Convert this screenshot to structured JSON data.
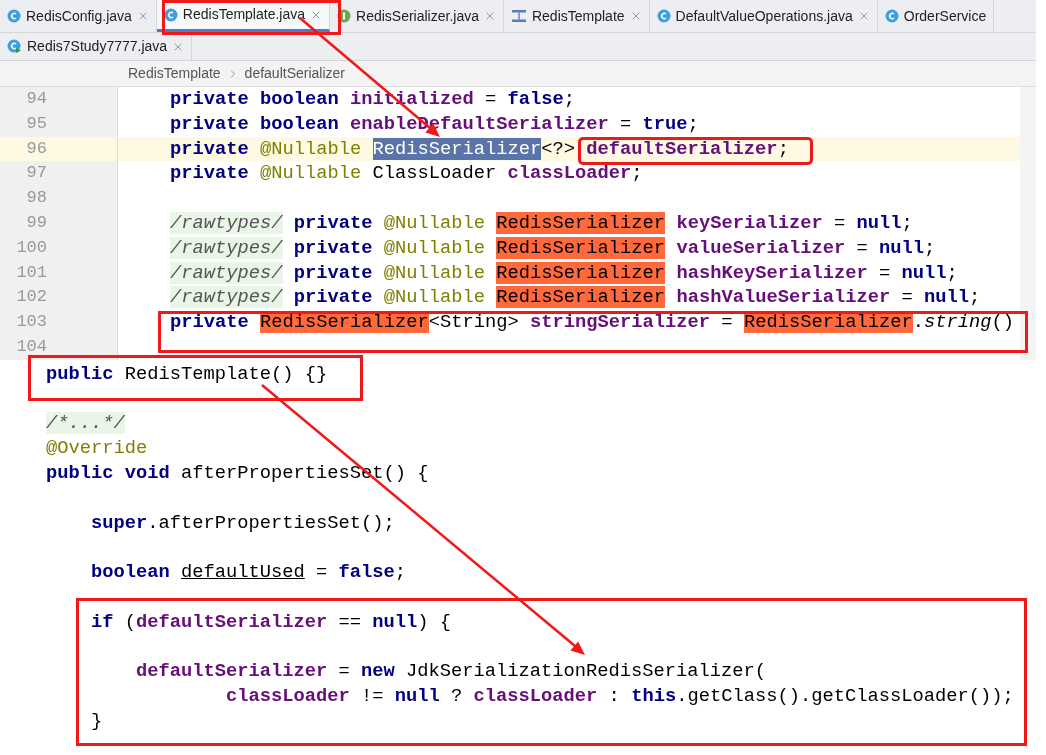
{
  "tab_rows": [
    {
      "tabs": [
        {
          "label": "RedisConfig.java",
          "kind": "class",
          "selected": false,
          "closable": true
        },
        {
          "label": "RedisTemplate.java",
          "kind": "class",
          "selected": true,
          "closable": true
        },
        {
          "label": "RedisSerializer.java",
          "kind": "interface",
          "selected": false,
          "closable": true
        },
        {
          "label": "RedisTemplate",
          "kind": "structure",
          "selected": false,
          "closable": true
        },
        {
          "label": "DefaultValueOperations.java",
          "kind": "class",
          "selected": false,
          "closable": true
        },
        {
          "label": "OrderService",
          "kind": "class",
          "selected": false,
          "closable": false
        }
      ]
    },
    {
      "tabs": [
        {
          "label": "Redis7Study7777.java",
          "kind": "runnable",
          "selected": false,
          "closable": true
        }
      ]
    }
  ],
  "breadcrumb": [
    "RedisTemplate",
    "defaultSerializer"
  ],
  "editor_top": {
    "lines": [
      {
        "number": "94",
        "current": false,
        "tokens": [
          {
            "kind": "keyword",
            "text": "private boolean "
          },
          {
            "kind": "field",
            "text": "initialized"
          },
          {
            "kind": "plain",
            "text": " = "
          },
          {
            "kind": "keyword",
            "text": "false"
          },
          {
            "kind": "plain",
            "text": ";"
          }
        ]
      },
      {
        "number": "95",
        "current": false,
        "tokens": [
          {
            "kind": "keyword",
            "text": "private boolean "
          },
          {
            "kind": "field",
            "text": "enableDefaultSerializer"
          },
          {
            "kind": "plain",
            "text": " = "
          },
          {
            "kind": "keyword",
            "text": "true"
          },
          {
            "kind": "plain",
            "text": ";"
          }
        ]
      },
      {
        "number": "96",
        "current": true,
        "tokens": [
          {
            "kind": "keyword",
            "text": "private "
          },
          {
            "kind": "annotation",
            "text": "@Nullable "
          },
          {
            "kind": "selected",
            "text": "RedisSerializer"
          },
          {
            "kind": "plain",
            "text": "<?> "
          },
          {
            "kind": "field",
            "text": "defaultSerializer"
          },
          {
            "kind": "plain",
            "text": ";"
          }
        ]
      },
      {
        "number": "97",
        "current": false,
        "tokens": [
          {
            "kind": "keyword",
            "text": "private "
          },
          {
            "kind": "annotation",
            "text": "@Nullable "
          },
          {
            "kind": "plain",
            "text": "ClassLoader "
          },
          {
            "kind": "field",
            "text": "classLoader"
          },
          {
            "kind": "plain",
            "text": ";"
          }
        ]
      },
      {
        "number": "98",
        "current": false
      },
      {
        "number": "99",
        "current": false,
        "tokens": [
          {
            "kind": "folded",
            "text": "/rawtypes/"
          },
          {
            "kind": "keyword",
            "text": " private "
          },
          {
            "kind": "annotation",
            "text": "@Nullable "
          },
          {
            "kind": "usage",
            "text": "RedisSerializer"
          },
          {
            "kind": "field",
            "text": " keySerializer"
          },
          {
            "kind": "plain",
            "text": " = "
          },
          {
            "kind": "keyword",
            "text": "null"
          },
          {
            "kind": "plain",
            "text": ";"
          }
        ]
      },
      {
        "number": "100",
        "current": false,
        "tokens": [
          {
            "kind": "folded",
            "text": "/rawtypes/"
          },
          {
            "kind": "keyword",
            "text": " private "
          },
          {
            "kind": "annotation",
            "text": "@Nullable "
          },
          {
            "kind": "usage",
            "text": "RedisSerializer"
          },
          {
            "kind": "field",
            "text": " valueSerializer"
          },
          {
            "kind": "plain",
            "text": " = "
          },
          {
            "kind": "keyword",
            "text": "null"
          },
          {
            "kind": "plain",
            "text": ";"
          }
        ]
      },
      {
        "number": "101",
        "current": false,
        "tokens": [
          {
            "kind": "folded",
            "text": "/rawtypes/"
          },
          {
            "kind": "keyword",
            "text": " private "
          },
          {
            "kind": "annotation",
            "text": "@Nullable "
          },
          {
            "kind": "usage",
            "text": "RedisSerializer"
          },
          {
            "kind": "field",
            "text": " hashKeySerializer"
          },
          {
            "kind": "plain",
            "text": " = "
          },
          {
            "kind": "keyword",
            "text": "null"
          },
          {
            "kind": "plain",
            "text": ";"
          }
        ]
      },
      {
        "number": "102",
        "current": false,
        "tokens": [
          {
            "kind": "folded",
            "text": "/rawtypes/"
          },
          {
            "kind": "keyword",
            "text": " private "
          },
          {
            "kind": "annotation",
            "text": "@Nullable "
          },
          {
            "kind": "usage",
            "text": "RedisSerializer"
          },
          {
            "kind": "field",
            "text": " hashValueSerializer"
          },
          {
            "kind": "plain",
            "text": " = "
          },
          {
            "kind": "keyword",
            "text": "null"
          },
          {
            "kind": "plain",
            "text": ";"
          }
        ]
      },
      {
        "number": "103",
        "current": false,
        "tokens": [
          {
            "kind": "keyword",
            "text": "private "
          },
          {
            "kind": "usage",
            "text": "RedisSerializer"
          },
          {
            "kind": "plain",
            "text": "<String> "
          },
          {
            "kind": "field",
            "text": "stringSerializer"
          },
          {
            "kind": "plain",
            "text": " = "
          },
          {
            "kind": "usage",
            "text": "RedisSerializer"
          },
          {
            "kind": "plain",
            "text": "."
          },
          {
            "kind": "static",
            "text": "string"
          },
          {
            "kind": "plain",
            "text": "()"
          }
        ]
      },
      {
        "number": "104",
        "current": false
      }
    ]
  },
  "editor_bottom": {
    "lines": [
      {
        "kind": "code",
        "tokens": [
          {
            "kind": "keyword",
            "text": "public "
          },
          {
            "kind": "plain",
            "text": "RedisTemplate() {}"
          }
        ]
      },
      {
        "kind": "blank"
      },
      {
        "kind": "code",
        "tokens": [
          {
            "kind": "folded",
            "text": "/*...*/"
          }
        ]
      },
      {
        "kind": "code",
        "tokens": [
          {
            "kind": "annotation",
            "text": "@Override"
          }
        ]
      },
      {
        "kind": "code",
        "tokens": [
          {
            "kind": "keyword",
            "text": "public void "
          },
          {
            "kind": "plain",
            "text": "afterPropertiesSet() {"
          }
        ],
        "children": [
          {
            "kind": "blank"
          },
          {
            "kind": "code",
            "tokens": [
              {
                "kind": "keyword",
                "text": "super"
              },
              {
                "kind": "plain",
                "text": ".afterPropertiesSet();"
              }
            ]
          },
          {
            "kind": "blank"
          },
          {
            "kind": "code",
            "tokens": [
              {
                "kind": "keyword",
                "text": "boolean "
              },
              {
                "kind": "local",
                "text": "defaultUsed"
              },
              {
                "kind": "plain",
                "text": " = "
              },
              {
                "kind": "keyword",
                "text": "false"
              },
              {
                "kind": "plain",
                "text": ";"
              }
            ]
          },
          {
            "kind": "blank"
          },
          {
            "kind": "code",
            "tokens": [
              {
                "kind": "keyword",
                "text": "if "
              },
              {
                "kind": "plain",
                "text": "("
              },
              {
                "kind": "field",
                "text": "defaultSerializer"
              },
              {
                "kind": "plain",
                "text": " == "
              },
              {
                "kind": "keyword",
                "text": "null"
              },
              {
                "kind": "plain",
                "text": ") {"
              }
            ],
            "children": [
              {
                "kind": "blank"
              },
              {
                "kind": "code",
                "tokens": [
                  {
                    "kind": "field",
                    "text": "defaultSerializer"
                  },
                  {
                    "kind": "plain",
                    "text": " = "
                  },
                  {
                    "kind": "keyword",
                    "text": "new "
                  },
                  {
                    "kind": "plain",
                    "text": "JdkSerializationRedisSerializer("
                  }
                ],
                "children": [
                  {
                    "kind": "continuation",
                    "tokens": [
                      {
                        "kind": "field",
                        "text": "classLoader"
                      },
                      {
                        "kind": "plain",
                        "text": " != "
                      },
                      {
                        "kind": "keyword",
                        "text": "null"
                      },
                      {
                        "kind": "plain",
                        "text": " ? "
                      },
                      {
                        "kind": "field",
                        "text": "classLoader"
                      },
                      {
                        "kind": "plain",
                        "text": " : "
                      },
                      {
                        "kind": "keyword",
                        "text": "this"
                      },
                      {
                        "kind": "plain",
                        "text": ".getClass().getClassLoader());"
                      }
                    ]
                  }
                ]
              }
            ]
          },
          {
            "kind": "code",
            "tokens": [
              {
                "kind": "plain",
                "text": "}"
              }
            ]
          }
        ]
      }
    ]
  }
}
